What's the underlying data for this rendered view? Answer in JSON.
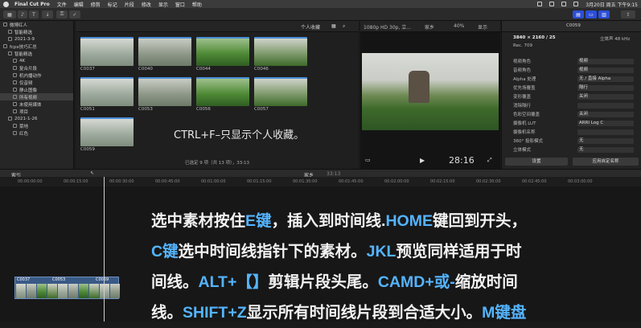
{
  "menubar": {
    "app_name": "Final Cut Pro",
    "items": [
      "文件",
      "编辑",
      "修剪",
      "标记",
      "片段",
      "修改",
      "显示",
      "窗口",
      "帮助"
    ],
    "datetime": "3月20日 周五 下午9:15"
  },
  "browser": {
    "items": [
      {
        "label": "微博红人",
        "indent": 0,
        "selected": false
      },
      {
        "label": "智能精选",
        "indent": 1,
        "selected": false
      },
      {
        "label": "2021-3-9",
        "indent": 1,
        "selected": false
      },
      {
        "label": "fcpx技巧汇总",
        "indent": 0,
        "selected": false
      },
      {
        "label": "智能精选",
        "indent": 1,
        "selected": false
      },
      {
        "label": "4K",
        "indent": 2,
        "selected": false
      },
      {
        "label": "复合片段",
        "indent": 2,
        "selected": false
      },
      {
        "label": "机内播动作",
        "indent": 2,
        "selected": false
      },
      {
        "label": "仅音频",
        "indent": 2,
        "selected": false
      },
      {
        "label": "静止图像",
        "indent": 2,
        "selected": false
      },
      {
        "label": "所有视频",
        "indent": 2,
        "selected": true
      },
      {
        "label": "未使用媒体",
        "indent": 2,
        "selected": false
      },
      {
        "label": "项目",
        "indent": 2,
        "selected": false
      },
      {
        "label": "2021-1-26",
        "indent": 1,
        "selected": false
      },
      {
        "label": "菜地",
        "indent": 2,
        "selected": false
      },
      {
        "label": "红色",
        "indent": 2,
        "selected": false
      }
    ]
  },
  "library": {
    "filter": "个人收藏",
    "clips": [
      "C0037",
      "C0040",
      "C0044",
      "C0046",
      "C0051",
      "C0053",
      "C0056",
      "C0057",
      "C0059"
    ],
    "status": "已选定 9 项（共 13 项），33:13",
    "overlay_note": "CTRL+F–只显示个人收藏。"
  },
  "viewer": {
    "format": "1080p HD 30p, 立...",
    "project": "家乡",
    "zoom": "40%",
    "view_label": "显示",
    "timecode": "28:16"
  },
  "inspector": {
    "clip": "C0059",
    "resolution": "3840 × 2160 / 25",
    "fps": "Rec. 709",
    "right_info": "立体声 48 kHz",
    "section": "设置",
    "apply_button": "应用自定名称",
    "rows": [
      {
        "key": "视频角色",
        "value": "视频"
      },
      {
        "key": "音频角色",
        "value": "视频"
      },
      {
        "key": "Alpha 处理",
        "value": "无 / 直接 Alpha"
      },
      {
        "key": "优先场覆盖",
        "value": "隔行"
      },
      {
        "key": "变形覆盖",
        "value": "关闭"
      },
      {
        "key": "消除隔行",
        "value": ""
      },
      {
        "key": "色彩空间覆盖",
        "value": "关闭"
      },
      {
        "key": "摄像机 LUT",
        "value": "ARRI Log C"
      },
      {
        "key": "摄像机名称",
        "value": ""
      },
      {
        "key": "360° 投影模式",
        "value": "无"
      },
      {
        "key": "立体模式",
        "value": "无"
      }
    ]
  },
  "timeline": {
    "index_label": "索引",
    "project": "家乡",
    "duration": "33:13",
    "ruler": [
      "00:00:00:00",
      "00:00:15:00",
      "00:00:30:00",
      "00:00:45:00",
      "00:01:00:00",
      "00:01:15:00",
      "00:01:30:00",
      "00:01:45:00",
      "00:02:00:00",
      "00:02:15:00",
      "00:02:30:00",
      "00:02:45:00",
      "00:03:00:00"
    ],
    "clip_labels": [
      "C0037",
      "C0053",
      "C0059"
    ]
  },
  "caption": {
    "lines": [
      [
        "选中素材按住",
        "E键",
        "，插入到时间线.",
        "HOME",
        "键回到开头，"
      ],
      [
        "C键",
        "选中时间线指针下的素材。",
        "JKL",
        "预览同样适用于时"
      ],
      [
        "间线。",
        "ALT+【】",
        "剪辑片段头尾。",
        "CAMD+或-",
        "缩放时间"
      ],
      [
        "线。",
        "SHIFT+Z",
        "显示所有时间线片段到合适大小。",
        "M键盘"
      ]
    ]
  },
  "colors": {
    "accent": "#54b4ff",
    "selection_blue": "#2d4fd6"
  }
}
